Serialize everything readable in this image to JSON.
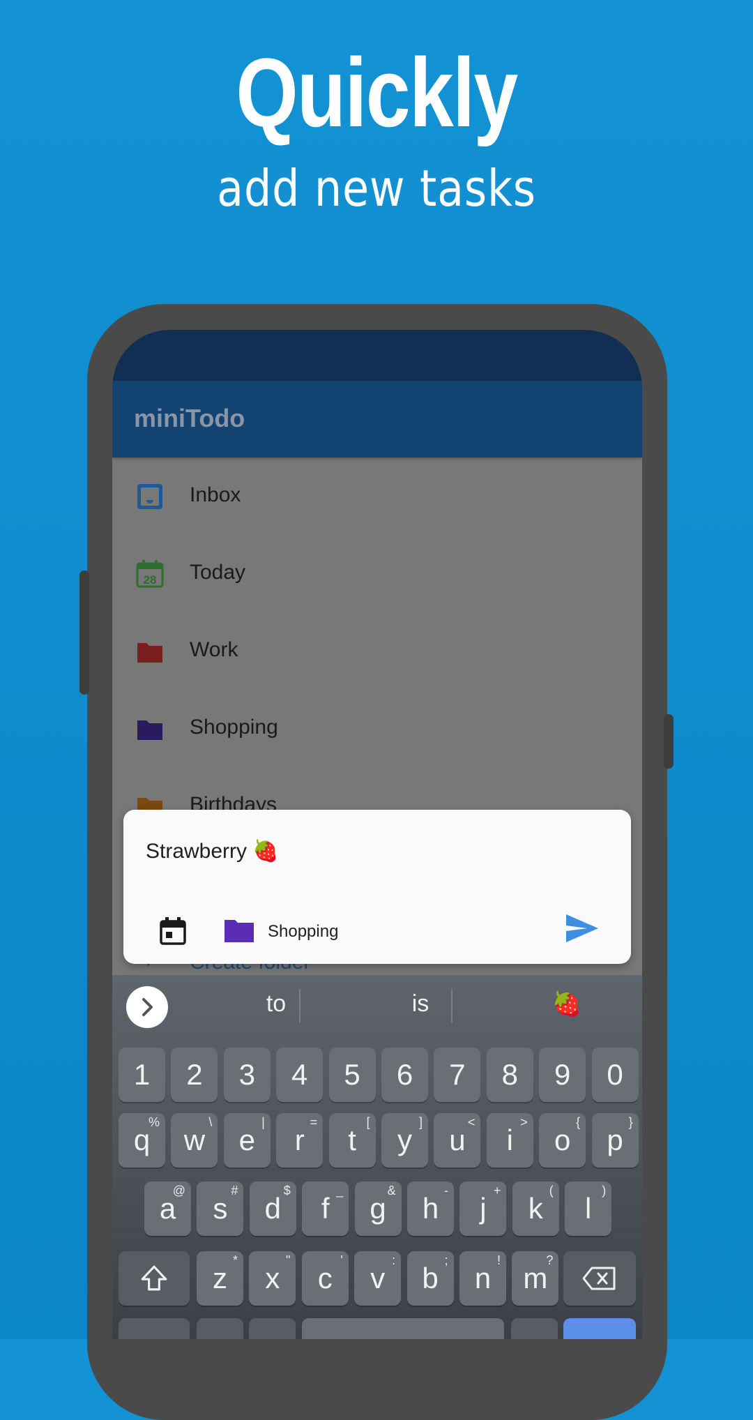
{
  "promo": {
    "headline": "Quickly",
    "subheadline": "add new tasks"
  },
  "app": {
    "title": "miniTodo",
    "colors": {
      "status_bar": "#102f52",
      "app_bar": "#134371",
      "accent": "#3f8fe0"
    },
    "lists": [
      {
        "label": "Inbox",
        "icon": "inbox-icon",
        "color": "#1d5a98"
      },
      {
        "label": "Today",
        "icon": "calendar-28-icon",
        "color": "#2e6e2e",
        "icon_text": "28"
      },
      {
        "label": "Work",
        "icon": "folder-icon",
        "color": "#7a1f1f"
      },
      {
        "label": "Shopping",
        "icon": "folder-icon",
        "color": "#2a1a5e"
      },
      {
        "label": "Birthdays",
        "icon": "folder-icon",
        "color": "#7a4a10"
      }
    ],
    "create_folder": {
      "label": "Create folder",
      "icon": "plus-icon"
    }
  },
  "task_card": {
    "text": "Strawberry 🍓",
    "date_icon": "calendar-icon",
    "folder": {
      "label": "Shopping",
      "color": "#5a2db4",
      "icon": "folder-icon"
    },
    "send_icon": "send-icon"
  },
  "keyboard": {
    "suggestions": [
      "to",
      "is",
      "🍓"
    ],
    "number_row": [
      "1",
      "2",
      "3",
      "4",
      "5",
      "6",
      "7",
      "8",
      "9",
      "0"
    ],
    "row1": [
      {
        "k": "q",
        "h": "%"
      },
      {
        "k": "w",
        "h": "\\"
      },
      {
        "k": "e",
        "h": "|"
      },
      {
        "k": "r",
        "h": "="
      },
      {
        "k": "t",
        "h": "["
      },
      {
        "k": "y",
        "h": "]"
      },
      {
        "k": "u",
        "h": "<"
      },
      {
        "k": "i",
        "h": ">"
      },
      {
        "k": "o",
        "h": "{"
      },
      {
        "k": "p",
        "h": "}"
      }
    ],
    "row2": [
      {
        "k": "a",
        "h": "@"
      },
      {
        "k": "s",
        "h": "#"
      },
      {
        "k": "d",
        "h": "$"
      },
      {
        "k": "f",
        "h": "_"
      },
      {
        "k": "g",
        "h": "&"
      },
      {
        "k": "h",
        "h": "-"
      },
      {
        "k": "j",
        "h": "+"
      },
      {
        "k": "k",
        "h": "("
      },
      {
        "k": "l",
        "h": ")"
      }
    ],
    "row3": [
      {
        "k": "z",
        "h": "*"
      },
      {
        "k": "x",
        "h": "\""
      },
      {
        "k": "c",
        "h": "'"
      },
      {
        "k": "v",
        "h": ":"
      },
      {
        "k": "b",
        "h": ";"
      },
      {
        "k": "n",
        "h": "!"
      },
      {
        "k": "m",
        "h": "?"
      }
    ]
  }
}
